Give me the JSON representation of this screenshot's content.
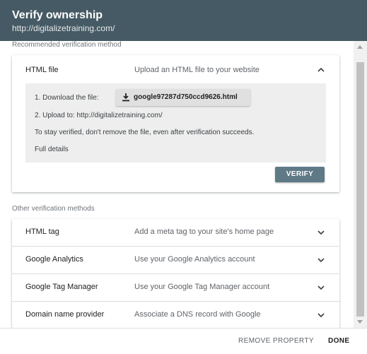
{
  "header": {
    "title": "Verify ownership",
    "subtitle": "http://digitalizetraining.com/"
  },
  "recommended": {
    "section_label": "Recommended verification method",
    "method_name": "HTML file",
    "method_desc": "Upload an HTML file to your website",
    "step1_label": "1. Download the file:",
    "file_name": "google97287d750ccd9626.html",
    "step2_label": "2. Upload to:",
    "step2_url": "http://digitalizetraining.com/",
    "note": "To stay verified, don't remove the file, even after verification succeeds.",
    "details_link": "Full details",
    "verify_label": "VERIFY"
  },
  "other": {
    "section_label": "Other verification methods",
    "methods": [
      {
        "name": "HTML tag",
        "desc": "Add a meta tag to your site's home page"
      },
      {
        "name": "Google Analytics",
        "desc": "Use your Google Analytics account"
      },
      {
        "name": "Google Tag Manager",
        "desc": "Use your Google Tag Manager account"
      },
      {
        "name": "Domain name provider",
        "desc": "Associate a DNS record with Google"
      }
    ]
  },
  "footer": {
    "remove_label": "REMOVE PROPERTY",
    "done_label": "DONE"
  },
  "icons": {
    "expand": "chevron-up-icon",
    "collapse": "chevron-down-icon",
    "download": "download-icon"
  },
  "colors": {
    "header_bg": "#455a64",
    "verify_bg": "#5f7987",
    "link": "#1a73e8"
  }
}
